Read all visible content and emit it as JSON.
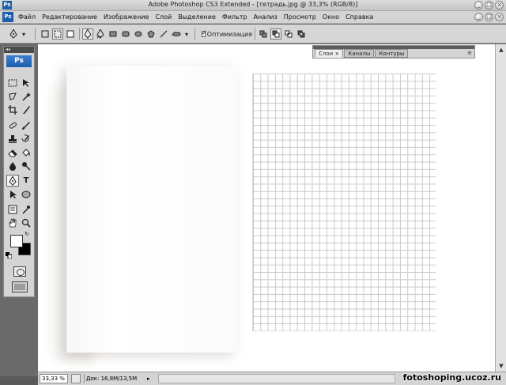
{
  "window": {
    "title": "Adobe Photoshop CS3 Extended - [тетрадь.jpg @ 33,3% (RGB/8)]",
    "app_badge": "Ps",
    "window_buttons": [
      "_",
      "□",
      "×"
    ]
  },
  "menu": {
    "items": [
      "Файл",
      "Редактирование",
      "Изображение",
      "Слой",
      "Выделение",
      "Фильтр",
      "Анализ",
      "Просмотр",
      "Окно",
      "Справка"
    ]
  },
  "options": {
    "checkbox_label": "Оптимизация",
    "checkbox_checked": true
  },
  "toolbox": {
    "header": "◂◂",
    "logo": "Ps"
  },
  "panel": {
    "tabs": [
      {
        "label": "Слои ×",
        "active": true
      },
      {
        "label": "Каналы",
        "active": false
      },
      {
        "label": "Контуры",
        "active": false
      }
    ],
    "menu_glyph": "≡"
  },
  "status": {
    "zoom": "33,33 %",
    "doc_size": "Док: 16,8M/13,5M",
    "arrow": "▸"
  },
  "watermark": "fotoshoping.ucoz.ru",
  "colors": {
    "foreground": "#ffffff",
    "background": "#000000",
    "ps_blue": "#1d5fa8"
  }
}
